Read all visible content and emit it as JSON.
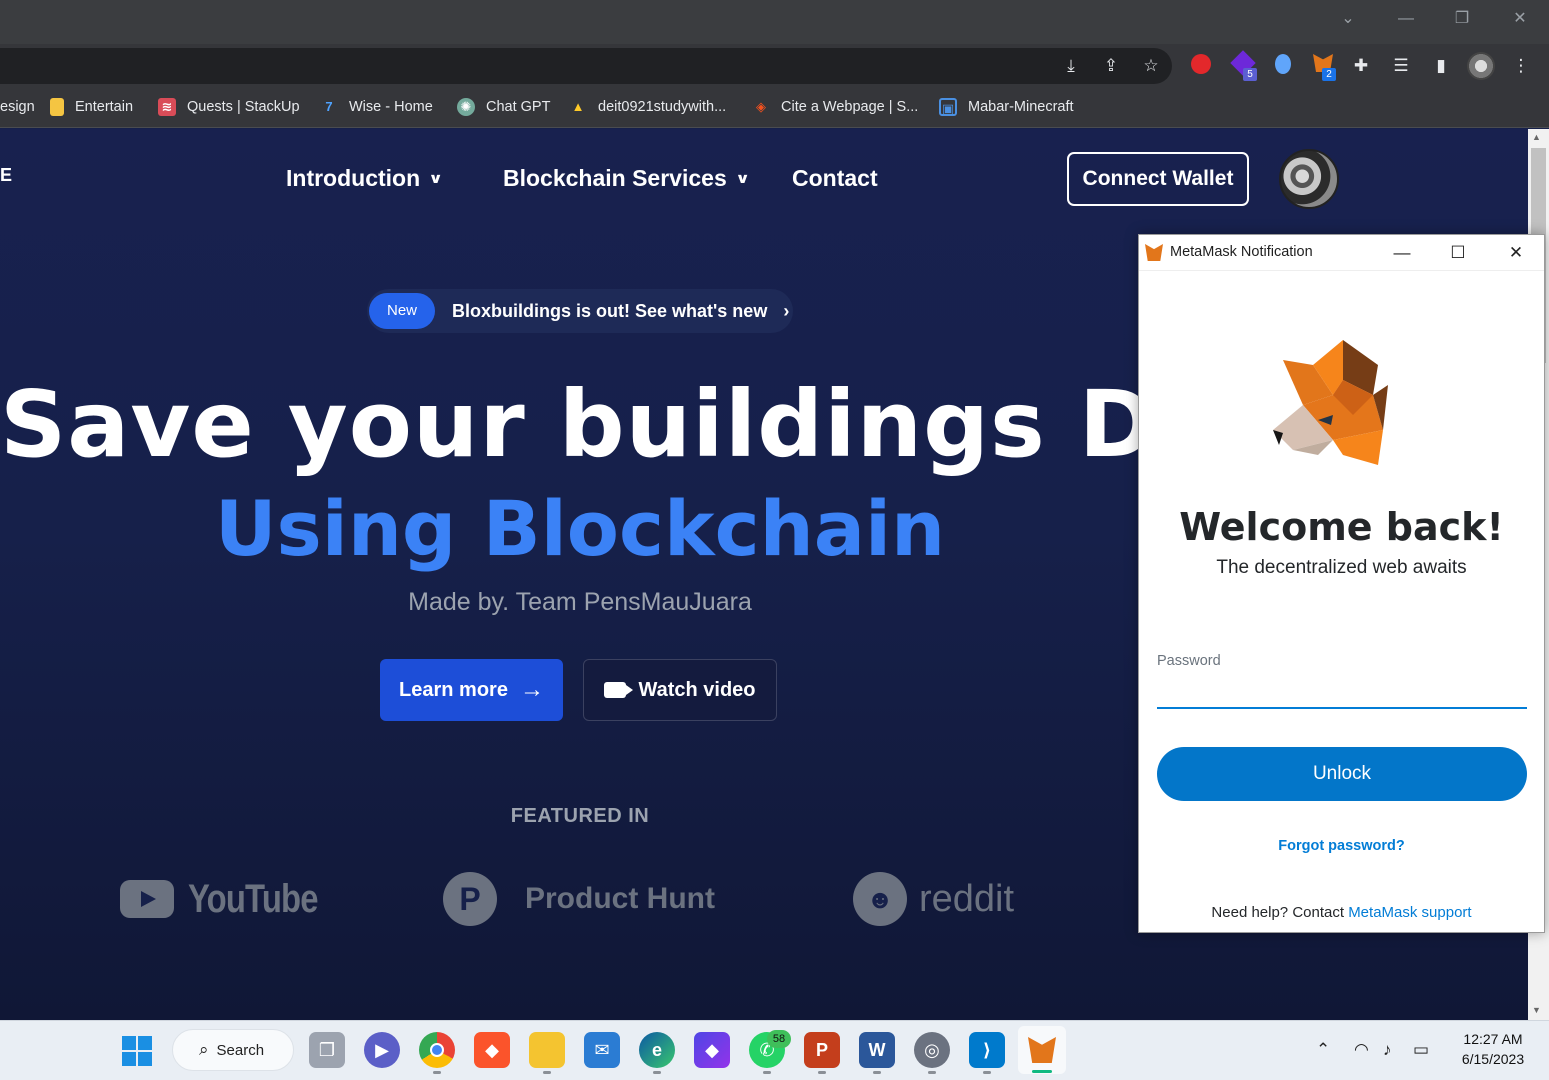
{
  "browser": {
    "bookmarks": [
      {
        "label": "esign",
        "icon": "bookmark-icon"
      },
      {
        "label": "Entertain",
        "icon": "folder-icon"
      },
      {
        "label": "Quests | StackUp",
        "icon": "stackup-icon"
      },
      {
        "label": "Wise - Home",
        "icon": "wise-icon"
      },
      {
        "label": "Chat GPT",
        "icon": "chatgpt-icon"
      },
      {
        "label": "deit0921studywith...",
        "icon": "firebase-icon"
      },
      {
        "label": "Cite a Webpage | S...",
        "icon": "cite-icon"
      },
      {
        "label": "Mabar-Minecraft",
        "icon": "minecraft-icon"
      }
    ],
    "extension_badges": {
      "ext1": "5",
      "ext2": "2"
    }
  },
  "site": {
    "logo_fragment": "E",
    "nav": {
      "introduction": "Introduction",
      "blockchain_services": "Blockchain Services",
      "contact": "Contact",
      "connect_wallet": "Connect Wallet"
    },
    "announcement": {
      "badge": "New",
      "text": "Bloxbuildings is out! See what's new",
      "arrow": "›"
    },
    "hero": {
      "line1": "Save your buildings Data",
      "line2": "Using Blockchain",
      "subtitle": "Made by. Team PensMauJuara"
    },
    "cta": {
      "learn_more": "Learn more",
      "learn_arrow": "→",
      "watch_video": "Watch video"
    },
    "featured": {
      "heading": "FEATURED IN",
      "logos": {
        "youtube": "YouTube",
        "producthunt": "Product Hunt",
        "producthunt_letter": "P",
        "reddit": "reddit"
      }
    }
  },
  "metamask": {
    "window_title": "MetaMask Notification",
    "welcome": "Welcome back!",
    "tagline": "The decentralized web awaits",
    "password_label": "Password",
    "password_value": "",
    "unlock": "Unlock",
    "forgot": "Forgot password?",
    "help_prefix": "Need help? Contact ",
    "help_link": "MetaMask support"
  },
  "taskbar": {
    "search_label": "Search",
    "whatsapp_badge": "58",
    "time": "12:27 AM",
    "date": "6/15/2023"
  },
  "colors": {
    "site_bg": "#16204a",
    "accent_blue": "#3b82f6",
    "button_blue": "#1d4ed8",
    "metamask_blue": "#0376c9"
  }
}
